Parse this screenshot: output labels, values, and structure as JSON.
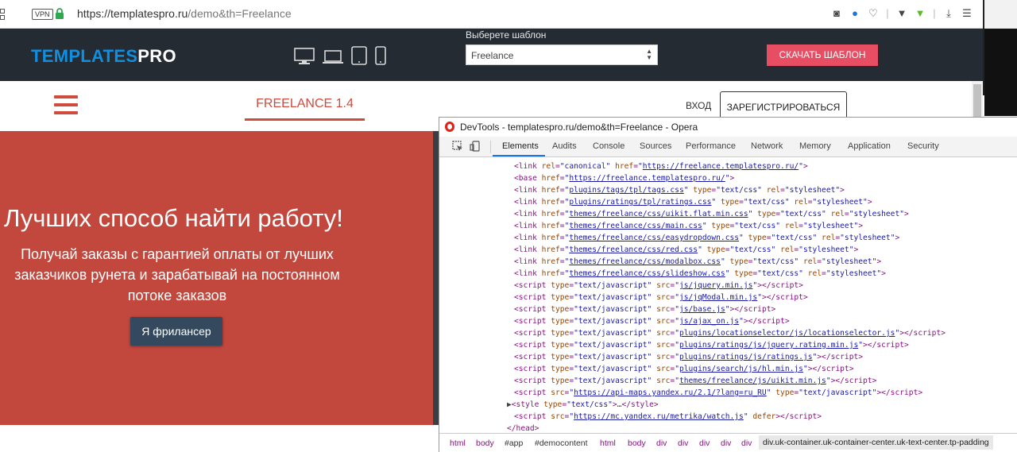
{
  "browser": {
    "vpn_label": "VPN",
    "url_domain": "https://templatespro.ru",
    "url_path": "/demo&th=Freelance"
  },
  "header": {
    "logo_part1": "TEMPLATES",
    "logo_part2": "PRO",
    "select_label": "Выберете шаблон",
    "select_value": "Freelance",
    "download_label": "СКАЧАТЬ ШАБЛОН",
    "colors": {
      "bg": "#252b33",
      "logo_blue": "#0e8fe0",
      "download": "#e74d63"
    }
  },
  "nav": {
    "title": "FREELANCE 1.4",
    "login_label": "ВХОД",
    "register_label": "ЗАРЕГИСТРИРОВАТЬСЯ",
    "accent": "#cf4b3e"
  },
  "hero": {
    "title": "Лучших способ найти работу!",
    "text": "Получай заказы с гарантией оплаты от лучших заказчиков рунета и зарабатывай на постоянном потоке заказов",
    "button_label": "Я фрилансер",
    "bg": "#c2473d"
  },
  "devtools": {
    "title": "DevTools - templatespro.ru/demo&th=Freelance - Opera",
    "tabs": [
      "Elements",
      "Audits",
      "Console",
      "Sources",
      "Performance",
      "Network",
      "Memory",
      "Application",
      "Security"
    ],
    "active_tab": "Elements",
    "links": [
      {
        "rel": "canonical",
        "href": "https://freelance.templatespro.ru/"
      },
      {
        "href": "plugins/tags/tpl/tags.css"
      },
      {
        "href": "plugins/ratings/tpl/ratings.css"
      },
      {
        "href": "themes/freelance/css/uikit.flat.min.css"
      },
      {
        "href": "themes/freelance/css/main.css"
      },
      {
        "href": "themes/freelance/css/easydropdown.css"
      },
      {
        "href": "themes/freelance/css/red.css"
      },
      {
        "href": "themes/freelance/css/modalbox.css"
      },
      {
        "href": "themes/freelance/css/slideshow.css"
      }
    ],
    "base_href": "https://freelance.templatespro.ru/",
    "scripts": [
      "js/jquery.min.js",
      "js/jqModal.min.js",
      "js/base.js",
      "js/ajax_on.js",
      "plugins/locationselector/js/locationselector.js",
      "plugins/ratings/js/jquery.rating.min.js",
      "plugins/ratings/js/ratings.js",
      "plugins/search/js/hl.min.js",
      "themes/freelance/js/uikit.min.js"
    ],
    "yandex_src": "https://api-maps.yandex.ru/2.1/?lang=ru_RU",
    "metrika_src": "https://mc.yandex.ru/metrika/watch.js",
    "breadcrumbs": [
      "html",
      "body",
      "#app",
      "#democontent",
      "html",
      "body",
      "div",
      "div",
      "div",
      "div",
      "div"
    ],
    "selected_crumb": "div.uk-container.uk-container-center.uk-text-center.tp-padding"
  }
}
